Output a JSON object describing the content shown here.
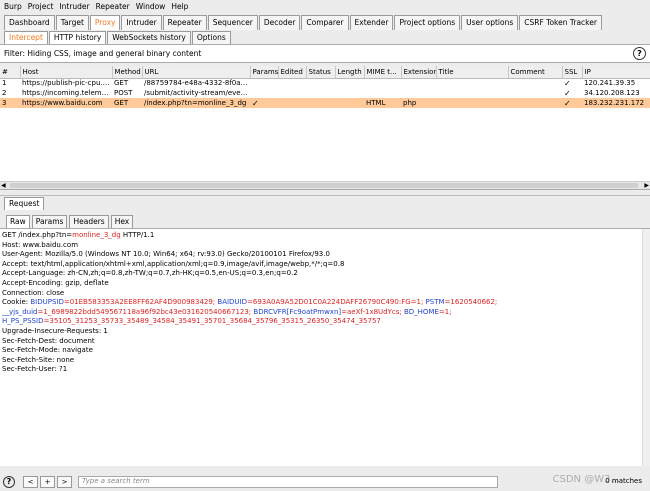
{
  "menu": [
    "Burp",
    "Project",
    "Intruder",
    "Repeater",
    "Window",
    "Help"
  ],
  "main_tabs": [
    "Dashboard",
    "Target",
    "Proxy",
    "Intruder",
    "Repeater",
    "Sequencer",
    "Decoder",
    "Comparer",
    "Extender",
    "Project options",
    "User options",
    "CSRF Token Tracker"
  ],
  "active_main_tab": "Proxy",
  "proxy_tabs": [
    "Intercept",
    "HTTP history",
    "WebSockets history",
    "Options"
  ],
  "filter_text": "Filter: Hiding CSS, image and general binary content",
  "history": {
    "columns": [
      "#",
      "Host",
      "Method",
      "URL",
      "Params",
      "Edited",
      "Status",
      "Length",
      "MIME t...",
      "Extension",
      "Title",
      "Comment",
      "SSL",
      "IP"
    ],
    "rows": [
      [
        "1",
        "https://publish-pic-cpu.bai...",
        "GET",
        "/88759784-e48a-4332-8f0a-f6409...",
        "",
        "",
        "",
        "",
        "",
        "",
        "",
        "",
        "✓",
        "120.241.39.35"
      ],
      [
        "2",
        "https://incoming.telemetry....",
        "POST",
        "/submit/activity-stream/events/1/...",
        "",
        "",
        "",
        "",
        "",
        "",
        "",
        "",
        "✓",
        "34.120.208.123"
      ],
      [
        "3",
        "https://www.baidu.com",
        "GET",
        "/index.php?tn=monline_3_dg",
        "✓",
        "",
        "",
        "",
        "HTML",
        "php",
        "",
        "",
        "✓",
        "183.232.231.172"
      ]
    ]
  },
  "request_tab": "Request",
  "view_tabs": [
    "Raw",
    "Params",
    "Headers",
    "Hex"
  ],
  "request_lines": {
    "l0a": "GET /index.php?tn=",
    "l0b": "monline_3_dg",
    "l0c": " HTTP/1.1",
    "l1": "Host: www.baidu.com",
    "l2": "User-Agent: Mozilla/5.0 (Windows NT 10.0; Win64; x64; rv:93.0) Gecko/20100101 Firefox/93.0",
    "l3": "Accept: text/html,application/xhtml+xml,application/xml;q=0.9,image/avif,image/webp,*/*;q=0.8",
    "l4": "Accept-Language: zh-CN,zh;q=0.8,zh-TW;q=0.7,zh-HK;q=0.5,en-US;q=0.3,en;q=0.2",
    "l5": "Accept-Encoding: gzip, deflate",
    "l6": "Connection: close",
    "l7a": "Cookie: ",
    "l7b": "BIDUPSID",
    "l7c": "=01EB583353A2EE8FF62AF4D900983429; ",
    "l7d": "BAIDUID",
    "l7e": "=693A0A9A52D01C0A224DAFF26790C490:FG=1; ",
    "l7f": "PSTM",
    "l7g": "=1620540662;",
    "l8a": "__yjs_duid",
    "l8b": "=1_6989822bdd549567118a96f92bc43e031620540667123; ",
    "l8c": "BDRCVFR[Fc9oatPmwxn]",
    "l8d": "=aeXf-1x8UdYcs; ",
    "l8e": "BD_HOME",
    "l8f": "=1;",
    "l9a": "H_PS_PSSID",
    "l9b": "=35105_31253_35733_35489_34584_35491_35701_35684_35796_35315_26350_35474_35757",
    "l10": "Upgrade-Insecure-Requests: 1",
    "l11": "Sec-Fetch-Dest: document",
    "l12": "Sec-Fetch-Mode: navigate",
    "l13": "Sec-Fetch-Site: none",
    "l14": "Sec-Fetch-User: ?1"
  },
  "bottom": {
    "help": "?",
    "prev": "<",
    "add": "+",
    "next": ">",
    "search_placeholder": "Type a search term",
    "matches": "0 matches",
    "watermark": "CSDN @W3..."
  },
  "colors": {
    "accent": "#f47a20",
    "selected_row": "#ffc999",
    "param_red": "#d22222",
    "param_blue": "#2244cc"
  }
}
